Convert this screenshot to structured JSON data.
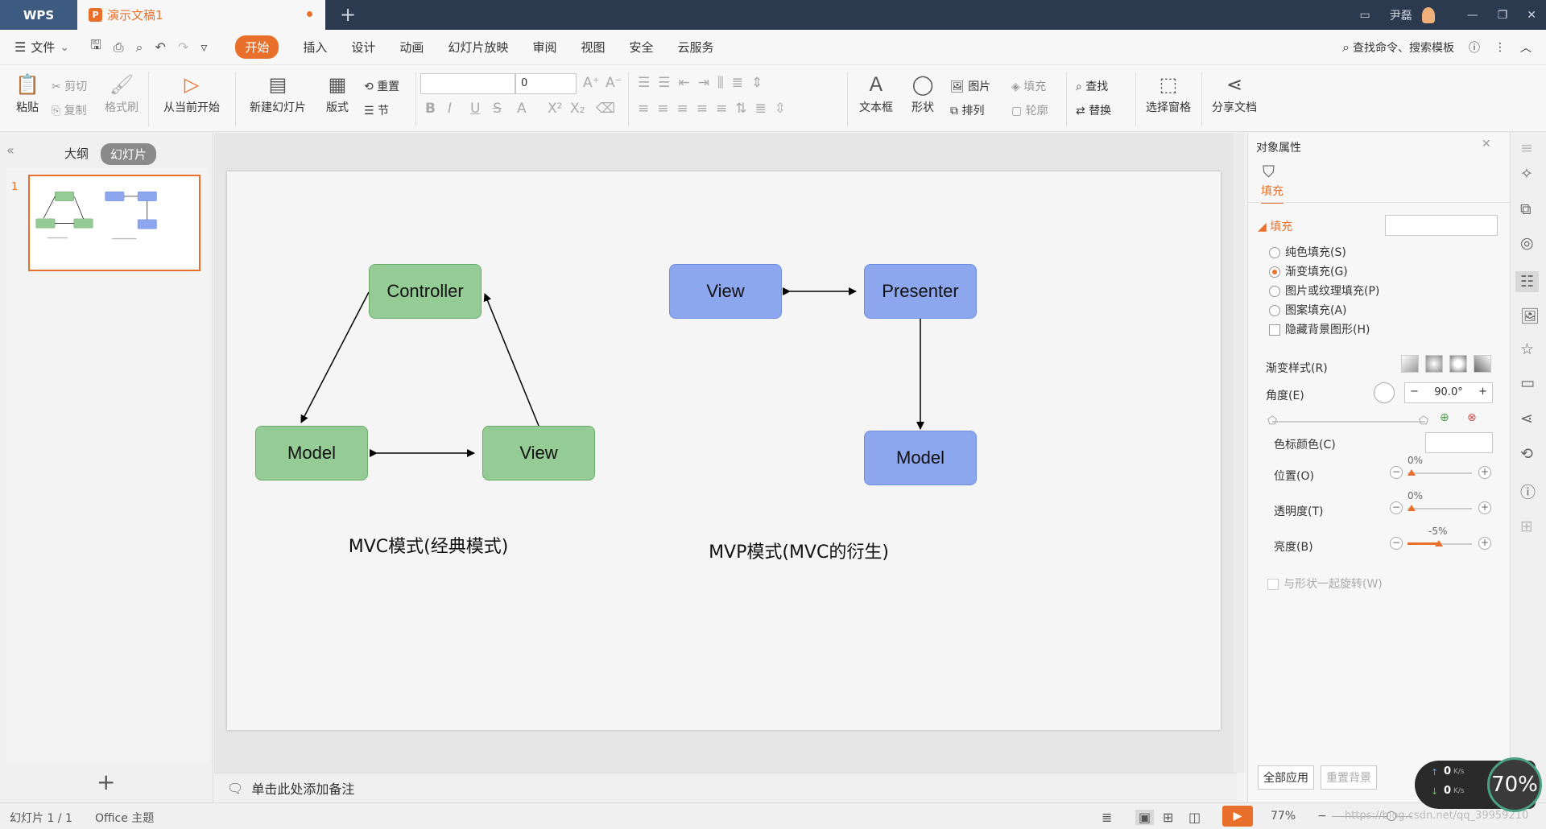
{
  "titlebar": {
    "app_name": "WPS",
    "doc_tab": "演示文稿1",
    "user": "尹磊"
  },
  "menu": {
    "file": "文件",
    "items": [
      "开始",
      "插入",
      "设计",
      "动画",
      "幻灯片放映",
      "审阅",
      "视图",
      "安全",
      "云服务"
    ],
    "search": "查找命令、搜索模板"
  },
  "ribbon": {
    "paste": "粘贴",
    "cut": "剪切",
    "copy": "复制",
    "format_painter": "格式刷",
    "from_current": "从当前开始",
    "new_slide": "新建幻灯片",
    "layout": "版式",
    "reset": "重置",
    "section": "节",
    "font_size": "0",
    "textbox": "文本框",
    "shape": "形状",
    "picture": "图片",
    "fill": "填充",
    "arrange": "排列",
    "outline": "轮廓",
    "find": "查找",
    "replace": "替换",
    "select_pane": "选择窗格",
    "share": "分享文档"
  },
  "leftpane": {
    "outline_tab": "大纲",
    "slides_tab": "幻灯片",
    "slide_number": "1"
  },
  "slide": {
    "mvc": {
      "controller": "Controller",
      "model": "Model",
      "view": "View",
      "caption": "MVC模式(经典模式)"
    },
    "mvp": {
      "view": "View",
      "presenter": "Presenter",
      "model": "Model",
      "caption": "MVP模式(MVC的衍生)"
    },
    "colors": {
      "green_fill": "#95cc95",
      "green_border": "#6aab6a",
      "blue_fill": "#8da7ee",
      "blue_border": "#6d8ee0"
    }
  },
  "notes": "单击此处添加备注",
  "rightpane": {
    "title": "对象属性",
    "fill_tab": "填充",
    "fill_section": "填充",
    "options": [
      "纯色填充(S)",
      "渐变填充(G)",
      "图片或纹理填充(P)",
      "图案填充(A)"
    ],
    "hide_bg": "隐藏背景图形(H)",
    "gradient_style": "渐变样式(R)",
    "angle": "角度(E)",
    "angle_value": "90.0°",
    "stop_color": "色标颜色(C)",
    "position": "位置(O)",
    "position_value": "0%",
    "transparency": "透明度(T)",
    "transparency_value": "0%",
    "brightness": "亮度(B)",
    "brightness_value": "-5%",
    "rotate_with_shape": "与形状一起旋转(W)",
    "apply_all": "全部应用",
    "reset_bg": "重置背景"
  },
  "statusbar": {
    "slide_info": "幻灯片 1 / 1",
    "theme": "Office 主题",
    "zoom": "77%",
    "watermark": "https://blog.csdn.net/qq_39959210"
  },
  "netwidget": {
    "up": "0",
    "down": "0",
    "unit": "K/s",
    "percent": "70%"
  }
}
